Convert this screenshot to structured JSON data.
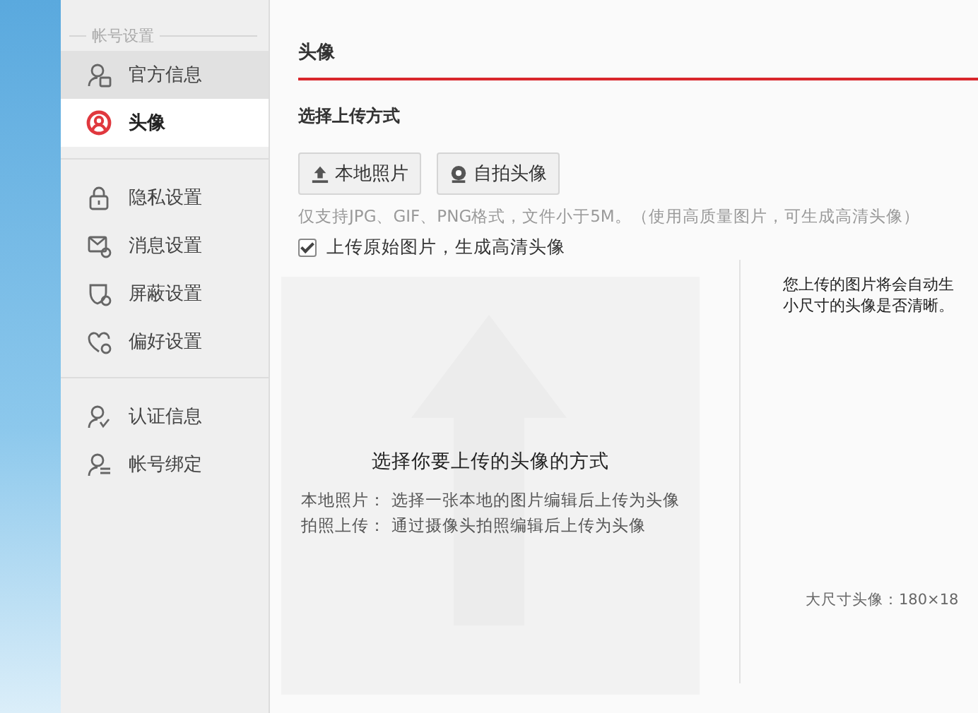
{
  "sidebar": {
    "heading": "帐号设置",
    "groups": [
      {
        "items": [
          {
            "label": "官方信息",
            "kind": "profile",
            "selected": false,
            "hover": true
          },
          {
            "label": "头像",
            "kind": "avatar",
            "selected": true,
            "hover": false
          }
        ]
      },
      {
        "items": [
          {
            "label": "隐私设置",
            "kind": "lock",
            "selected": false,
            "hover": false
          },
          {
            "label": "消息设置",
            "kind": "mail",
            "selected": false,
            "hover": false
          },
          {
            "label": "屏蔽设置",
            "kind": "shield",
            "selected": false,
            "hover": false
          },
          {
            "label": "偏好设置",
            "kind": "heart",
            "selected": false,
            "hover": false
          }
        ]
      },
      {
        "items": [
          {
            "label": "认证信息",
            "kind": "verify",
            "selected": false,
            "hover": false
          },
          {
            "label": "帐号绑定",
            "kind": "bind",
            "selected": false,
            "hover": false
          }
        ]
      }
    ]
  },
  "main": {
    "title": "头像",
    "section": "选择上传方式",
    "buttons": [
      {
        "label": "本地照片",
        "kind": "upload"
      },
      {
        "label": "自拍头像",
        "kind": "camera"
      }
    ],
    "hint": "仅支持JPG、GIF、PNG格式，文件小于5M。（使用高质量图片，可生成高清头像）",
    "option": {
      "label": "上传原始图片，生成高清头像",
      "checked": true
    },
    "dropzone": {
      "title": "选择你要上传的头像的方式",
      "lines": [
        "本地照片：  选择一张本地的图片编辑后上传为头像",
        "拍照上传：  通过摄像头拍照编辑后上传为头像"
      ]
    },
    "preview": {
      "lines": [
        "您上传的图片将会自动生",
        "小尺寸的头像是否清晰。"
      ],
      "size_label": "大尺寸头像：180×18"
    }
  }
}
